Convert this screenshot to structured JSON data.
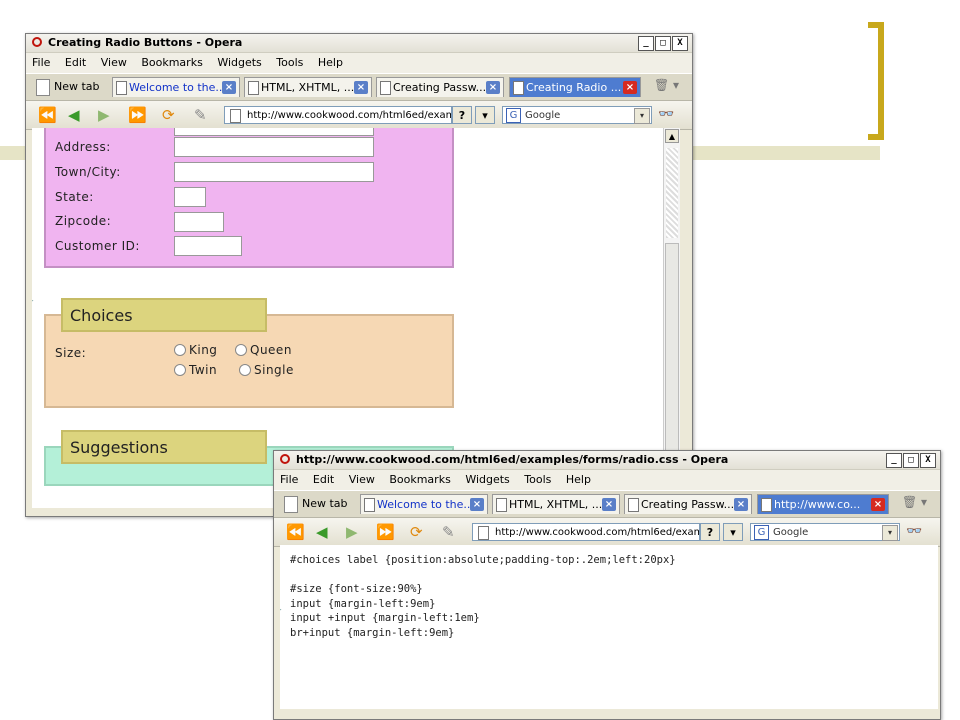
{
  "colors": {
    "accent_bracket": "#c8a81c",
    "form_pink": "#f0b4f0",
    "form_peach": "#f6d8b4",
    "form_green": "#b4f0d8",
    "legend_yellow": "#dcd47e",
    "active_tab": "#4e7cd0"
  },
  "icons": {
    "opera": "opera-logo-icon",
    "back": "rewind-icon",
    "previous": "back-arrow-icon",
    "next": "forward-arrow-icon",
    "fast_forward": "fast-forward-icon",
    "reload": "reload-icon",
    "edit": "pencil-icon",
    "glasses": "glasses-icon",
    "trash": "trash-icon"
  },
  "window1": {
    "title": "Creating Radio Buttons - Opera",
    "controls": [
      "_",
      "□",
      "X"
    ],
    "menu": [
      "File",
      "Edit",
      "View",
      "Bookmarks",
      "Widgets",
      "Tools",
      "Help"
    ],
    "newtab_label": "New tab",
    "tabs": [
      {
        "label": "Welcome to the..."
      },
      {
        "label": "HTML, XHTML, ..."
      },
      {
        "label": "Creating Passw..."
      },
      {
        "label": "Creating Radio ...",
        "active": true
      }
    ],
    "url": "http://www.cookwood.com/html6ed/exam",
    "url_help": "?",
    "search_placeholder": "Google",
    "form": {
      "fields": [
        {
          "label": "Address:"
        },
        {
          "label": "Town/City:"
        },
        {
          "label": "State:"
        },
        {
          "label": "Zipcode:"
        },
        {
          "label": "Customer ID:"
        }
      ],
      "choices_legend": "Choices",
      "size_label": "Size:",
      "radio_options": [
        "King",
        "Queen",
        "Twin",
        "Single"
      ],
      "suggestions_legend": "Suggestions"
    }
  },
  "window2": {
    "title": "http://www.cookwood.com/html6ed/examples/forms/radio.css - Opera",
    "controls": [
      "_",
      "□",
      "X"
    ],
    "menu": [
      "File",
      "Edit",
      "View",
      "Bookmarks",
      "Widgets",
      "Tools",
      "Help"
    ],
    "newtab_label": "New tab",
    "tabs": [
      {
        "label": "Welcome to the..."
      },
      {
        "label": "HTML, XHTML, ..."
      },
      {
        "label": "Creating Passw..."
      },
      {
        "label": "http://www.co...",
        "active": true
      }
    ],
    "url": "http://www.cookwood.com/html6ed/exam",
    "url_help": "?",
    "search_placeholder": "Google",
    "code_lines": [
      "#choices label {position:absolute;padding-top:.2em;left:20px}",
      "",
      "#size {font-size:90%}",
      "input {margin-left:9em}",
      "input +input {margin-left:1em}",
      "br+input {margin-left:9em}"
    ]
  }
}
